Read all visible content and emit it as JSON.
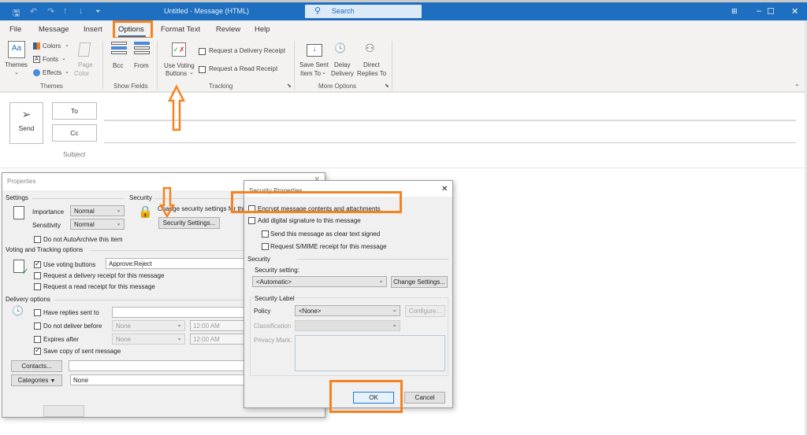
{
  "window": {
    "title": "Untitled  -  Message (HTML)",
    "search_placeholder": "Search",
    "quick_access": [
      "save-icon",
      "undo-icon",
      "redo-icon",
      "up-icon",
      "down-icon",
      "customize-icon"
    ]
  },
  "tabs": [
    "File",
    "Message",
    "Insert",
    "Options",
    "Format Text",
    "Review",
    "Help"
  ],
  "active_tab": "Options",
  "ribbon": {
    "themes": {
      "themes_label": "Themes",
      "colors": "Colors",
      "fonts": "Fonts",
      "effects": "Effects",
      "page_color_1": "Page",
      "page_color_2": "Color",
      "group": "Themes"
    },
    "show_fields": {
      "bcc": "Bcc",
      "from": "From",
      "group": "Show Fields"
    },
    "tracking": {
      "voting_1": "Use Voting",
      "voting_2": "Buttons",
      "delivery_receipt": "Request a Delivery Receipt",
      "read_receipt": "Request a Read Receipt",
      "group": "Tracking"
    },
    "more_options": {
      "save_sent_1": "Save Sent",
      "save_sent_2": "Item To",
      "delay_1": "Delay",
      "delay_2": "Delivery",
      "direct_1": "Direct",
      "direct_2": "Replies To",
      "group": "More Options"
    }
  },
  "compose": {
    "send": "Send",
    "to": "To",
    "cc": "Cc",
    "subject": "Subject"
  },
  "properties": {
    "title": "Properties",
    "settings_label": "Settings",
    "importance_label": "Importance",
    "importance_value": "Normal",
    "sensitivity_label": "Sensitivity",
    "sensitivity_value": "Normal",
    "no_autoarchive": "Do not AutoArchive this item",
    "security_label": "Security",
    "security_desc": "Change security settings for this message.",
    "security_settings_btn": "Security Settings...",
    "voting_label": "Voting and Tracking options",
    "use_voting": "Use voting buttons",
    "voting_value": "Approve;Reject",
    "req_delivery": "Request a delivery receipt for this message",
    "req_read": "Request a read receipt for this message",
    "delivery_label": "Delivery options",
    "have_replies": "Have replies sent to",
    "do_not_deliver": "Do not deliver before",
    "expires_after": "Expires after",
    "date_none": "None",
    "time_value": "12:00 AM",
    "save_copy": "Save copy of sent message",
    "contacts_btn": "Contacts...",
    "categories_btn": "Categories",
    "categories_value": "None"
  },
  "security_props": {
    "title": "Security Properties",
    "encrypt": "Encrypt message contents and attachments",
    "add_signature": "Add digital signature to this message",
    "clear_text": "Send this message as clear text signed",
    "smime_receipt": "Request S/MIME receipt for this message",
    "security_section": "Security",
    "security_setting_label": "Security setting:",
    "security_setting_value": "<Automatic>",
    "change_settings_btn": "Change Settings...",
    "label_section": "Security Label",
    "policy_label": "Policy",
    "policy_value": "<None>",
    "configure_btn": "Configure...",
    "classification_label": "Classification",
    "privacy_label": "Privacy Mark:",
    "ok_btn": "OK",
    "cancel_btn": "Cancel"
  },
  "annotation_color": "#f58220"
}
